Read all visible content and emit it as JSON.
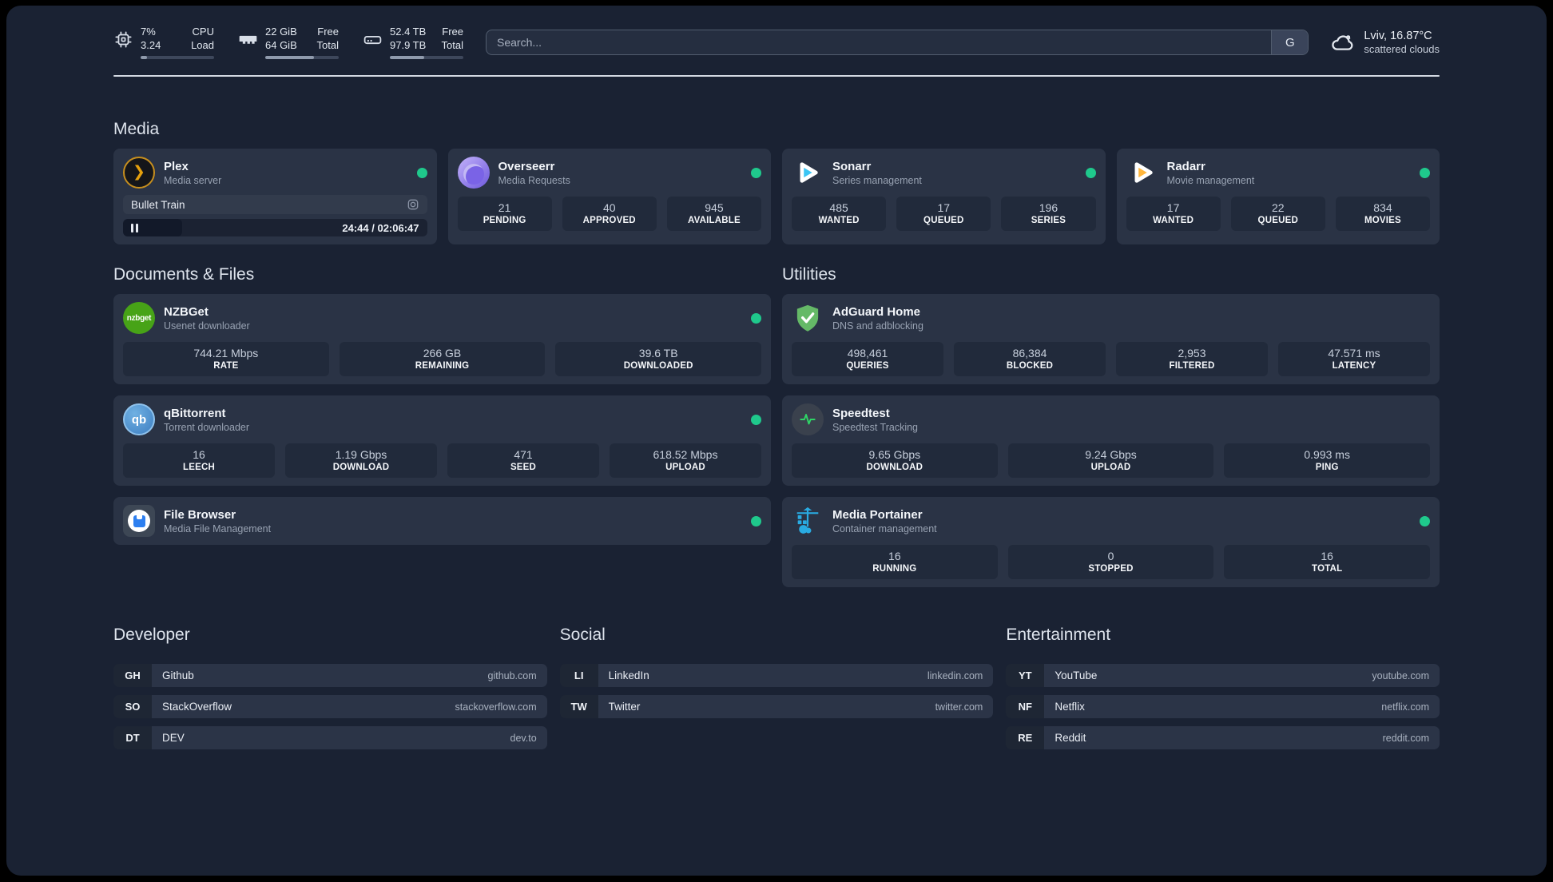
{
  "header": {
    "system_stats": [
      {
        "icon": "cpu-icon",
        "value_top": "7%",
        "value_bottom": "3.24",
        "label_top": "CPU",
        "label_bottom": "Load",
        "progress_pct": 9
      },
      {
        "icon": "memory-icon",
        "value_top": "22 GiB",
        "value_bottom": "64 GiB",
        "label_top": "Free",
        "label_bottom": "Total",
        "progress_pct": 66
      },
      {
        "icon": "disk-icon",
        "value_top": "52.4 TB",
        "value_bottom": "97.9 TB",
        "label_top": "Free",
        "label_bottom": "Total",
        "progress_pct": 47
      }
    ],
    "search": {
      "placeholder": "Search...",
      "provider_label": "G"
    },
    "weather": {
      "icon": "cloud-icon",
      "location_temp": "Lviv, 16.87°C",
      "condition": "scattered clouds"
    }
  },
  "sections": {
    "media": {
      "title": "Media"
    },
    "documents": {
      "title": "Documents & Files"
    },
    "utilities": {
      "title": "Utilities"
    },
    "developer": {
      "title": "Developer"
    },
    "social": {
      "title": "Social"
    },
    "entertainment": {
      "title": "Entertainment"
    }
  },
  "services": {
    "plex": {
      "name": "Plex",
      "desc": "Media server",
      "online": true,
      "player": {
        "title": "Bullet Train",
        "time": "24:44 / 02:06:47",
        "progress_pct": 19.5
      }
    },
    "overseerr": {
      "name": "Overseerr",
      "desc": "Media Requests",
      "online": true,
      "stats": [
        {
          "value": "21",
          "label": "PENDING"
        },
        {
          "value": "40",
          "label": "APPROVED"
        },
        {
          "value": "945",
          "label": "AVAILABLE"
        }
      ]
    },
    "sonarr": {
      "name": "Sonarr",
      "desc": "Series management",
      "online": true,
      "stats": [
        {
          "value": "485",
          "label": "WANTED"
        },
        {
          "value": "17",
          "label": "QUEUED"
        },
        {
          "value": "196",
          "label": "SERIES"
        }
      ]
    },
    "radarr": {
      "name": "Radarr",
      "desc": "Movie management",
      "online": true,
      "stats": [
        {
          "value": "17",
          "label": "WANTED"
        },
        {
          "value": "22",
          "label": "QUEUED"
        },
        {
          "value": "834",
          "label": "MOVIES"
        }
      ]
    },
    "nzbget": {
      "name": "NZBGet",
      "desc": "Usenet downloader",
      "online": true,
      "logo_text": "nzbget",
      "stats": [
        {
          "value": "744.21 Mbps",
          "label": "RATE"
        },
        {
          "value": "266 GB",
          "label": "REMAINING"
        },
        {
          "value": "39.6 TB",
          "label": "DOWNLOADED"
        }
      ]
    },
    "qbittorrent": {
      "name": "qBittorrent",
      "desc": "Torrent downloader",
      "online": true,
      "logo_text": "qb",
      "stats": [
        {
          "value": "16",
          "label": "LEECH"
        },
        {
          "value": "1.19 Gbps",
          "label": "DOWNLOAD"
        },
        {
          "value": "471",
          "label": "SEED"
        },
        {
          "value": "618.52 Mbps",
          "label": "UPLOAD"
        }
      ]
    },
    "filebrowser": {
      "name": "File Browser",
      "desc": "Media File Management",
      "online": true
    },
    "adguard": {
      "name": "AdGuard Home",
      "desc": "DNS and adblocking",
      "online": false,
      "stats": [
        {
          "value": "498,461",
          "label": "QUERIES"
        },
        {
          "value": "86,384",
          "label": "BLOCKED"
        },
        {
          "value": "2,953",
          "label": "FILTERED"
        },
        {
          "value": "47.571 ms",
          "label": "LATENCY"
        }
      ]
    },
    "speedtest": {
      "name": "Speedtest",
      "desc": "Speedtest Tracking",
      "online": false,
      "stats": [
        {
          "value": "9.65 Gbps",
          "label": "DOWNLOAD"
        },
        {
          "value": "9.24 Gbps",
          "label": "UPLOAD"
        },
        {
          "value": "0.993 ms",
          "label": "PING"
        }
      ]
    },
    "portainer": {
      "name": "Media Portainer",
      "desc": "Container management",
      "online": true,
      "stats": [
        {
          "value": "16",
          "label": "RUNNING"
        },
        {
          "value": "0",
          "label": "STOPPED"
        },
        {
          "value": "16",
          "label": "TOTAL"
        }
      ]
    }
  },
  "bookmarks": {
    "developer": [
      {
        "abbr": "GH",
        "name": "Github",
        "url": "github.com"
      },
      {
        "abbr": "SO",
        "name": "StackOverflow",
        "url": "stackoverflow.com"
      },
      {
        "abbr": "DT",
        "name": "DEV",
        "url": "dev.to"
      }
    ],
    "social": [
      {
        "abbr": "LI",
        "name": "LinkedIn",
        "url": "linkedin.com"
      },
      {
        "abbr": "TW",
        "name": "Twitter",
        "url": "twitter.com"
      }
    ],
    "entertainment": [
      {
        "abbr": "YT",
        "name": "YouTube",
        "url": "youtube.com"
      },
      {
        "abbr": "NF",
        "name": "Netflix",
        "url": "netflix.com"
      },
      {
        "abbr": "RE",
        "name": "Reddit",
        "url": "reddit.com"
      }
    ]
  },
  "icons": {
    "pause": "❚❚",
    "plex_chevron": "❯",
    "status_dot": "circle",
    "cpu": "chip",
    "memory": "ram-stick",
    "disk": "drive",
    "weather": "cloud-outline",
    "plex_widget": "gear-square"
  },
  "colors": {
    "page_bg": "#1a2233",
    "card_bg": "#2a3345",
    "stat_bg": "#212a3b",
    "status_online": "#1fc98c",
    "plex_accent": "#e5a00d",
    "overseerr_accent": "#7a63e6",
    "sonarr_accent": "#3bc5f4",
    "radarr_accent": "#ffb63c",
    "nzbget_accent": "#47a317",
    "qbittorrent_accent": "#3e7fc2",
    "filebrowser_accent": "#2d7ff0",
    "adguard_accent": "#65b967",
    "speedtest_accent": "#2fd566",
    "portainer_accent": "#29abe2"
  }
}
